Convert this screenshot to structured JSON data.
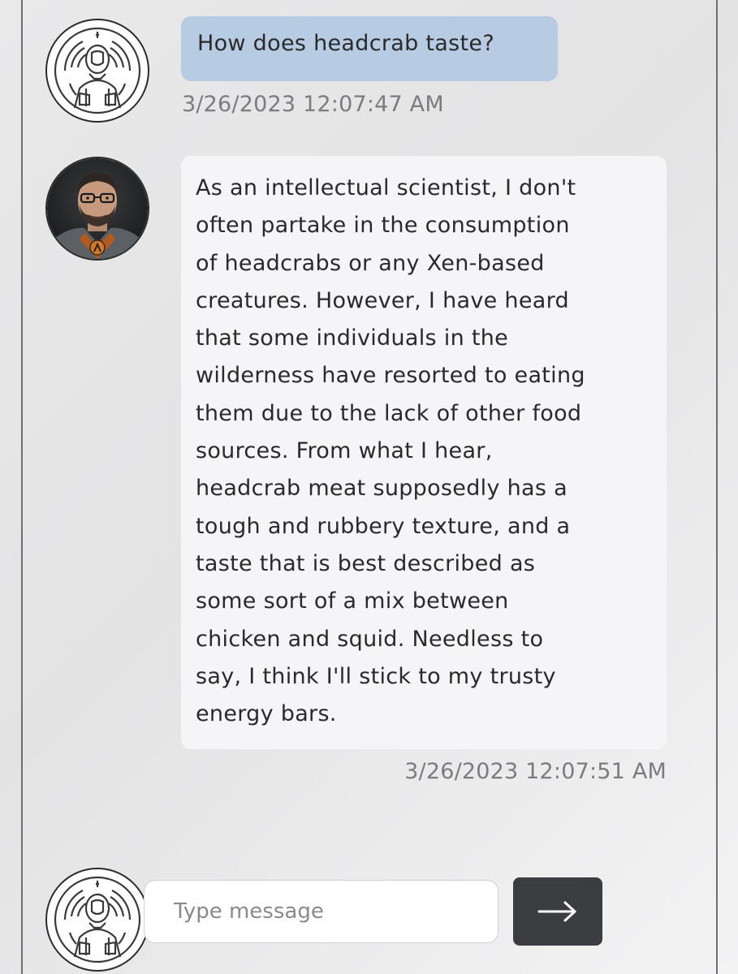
{
  "conversation": {
    "messages": [
      {
        "role": "user",
        "text": "How does headcrab taste?",
        "timestamp": "3/26/2023 12:07:47 AM"
      },
      {
        "role": "assistant",
        "lines": [
          "As an intellectual scientist, I don't",
          "often partake in the consumption",
          "of headcrabs or any Xen-based",
          "creatures. However, I have heard",
          "that some individuals in the",
          "wilderness have resorted to eating",
          "them due to the lack of other food",
          "sources. From what I hear,",
          "headcrab meat supposedly has a",
          "tough and rubbery texture, and a",
          "taste that is best described as",
          "some sort of a mix between",
          "chicken and squid. Needless to",
          "say, I think I'll stick to my trusty",
          "energy bars."
        ],
        "timestamp": "3/26/2023 12:07:51 AM"
      }
    ]
  },
  "composer": {
    "placeholder": "Type message",
    "value": "",
    "send_icon": "arrow-right-icon"
  },
  "colors": {
    "user_bubble": "#b7cce3",
    "assistant_bubble": "#f5f5f7",
    "send_button": "#3b3d41",
    "timestamp_text": "#7c7c80"
  },
  "icons": {
    "user_avatar": "user-avatar-icon",
    "assistant_avatar": "scientist-avatar-icon"
  }
}
